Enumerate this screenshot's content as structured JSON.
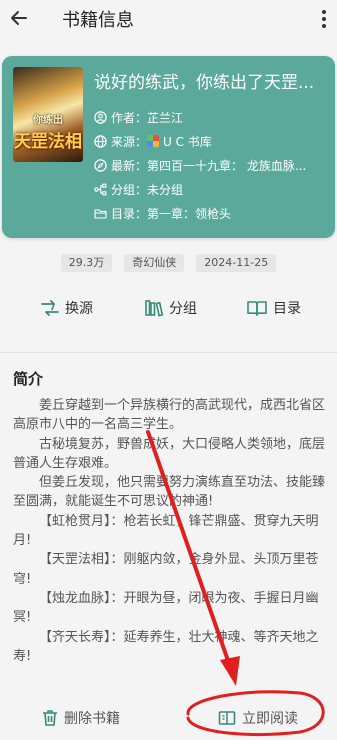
{
  "header": {
    "title": "书籍信息",
    "back_icon": "arrow-left-icon",
    "more_icon": "more-vertical-icon"
  },
  "book": {
    "title": "说好的练武，你练出了天罡...",
    "cover_top_text": "你练出",
    "cover_big_text": "天罡法相",
    "author_label": "作者：",
    "author": "芷兰江",
    "source_label": "来源：",
    "source": "U C 书库",
    "latest_label": "最新：",
    "latest": "第四百一十九章： 龙族血脉...",
    "group_label": "分组：",
    "group": "未分组",
    "toc_label": "目录：",
    "toc": "第一章：领枪头",
    "card_color": "#5ba99a"
  },
  "tags": [
    "29.3万",
    "奇幻仙侠",
    "2024-11-25"
  ],
  "actions": {
    "change_source": "换源",
    "group": "分组",
    "toc": "目录"
  },
  "intro": {
    "heading": "简介",
    "paragraphs": [
      "姜丘穿越到一个异族横行的高武现代，成西北省区高原市八中的一名高三学生。",
      "古秘境复苏，野兽成妖，大口侵略人类领地，底层普通人生存艰难。",
      "但姜丘发现，他只需要努力演练直至功法、技能臻至圆满，就能诞生不可思议的神通!",
      "【虹枪贯月】：枪若长虹，锋芒鼎盛、贯穿九天明月!",
      "【天罡法相】：刚躯内敛，金身外显、头顶万里苍穹!",
      "【烛龙血脉】：开眼为昼，闭眼为夜、手握日月幽冥!",
      "【齐天长寿】：延寿养生，壮大神魂、等齐天地之寿!"
    ]
  },
  "bottom": {
    "delete_label": "删除书籍",
    "read_label": "立即阅读"
  },
  "annotation_color": "#e02020"
}
